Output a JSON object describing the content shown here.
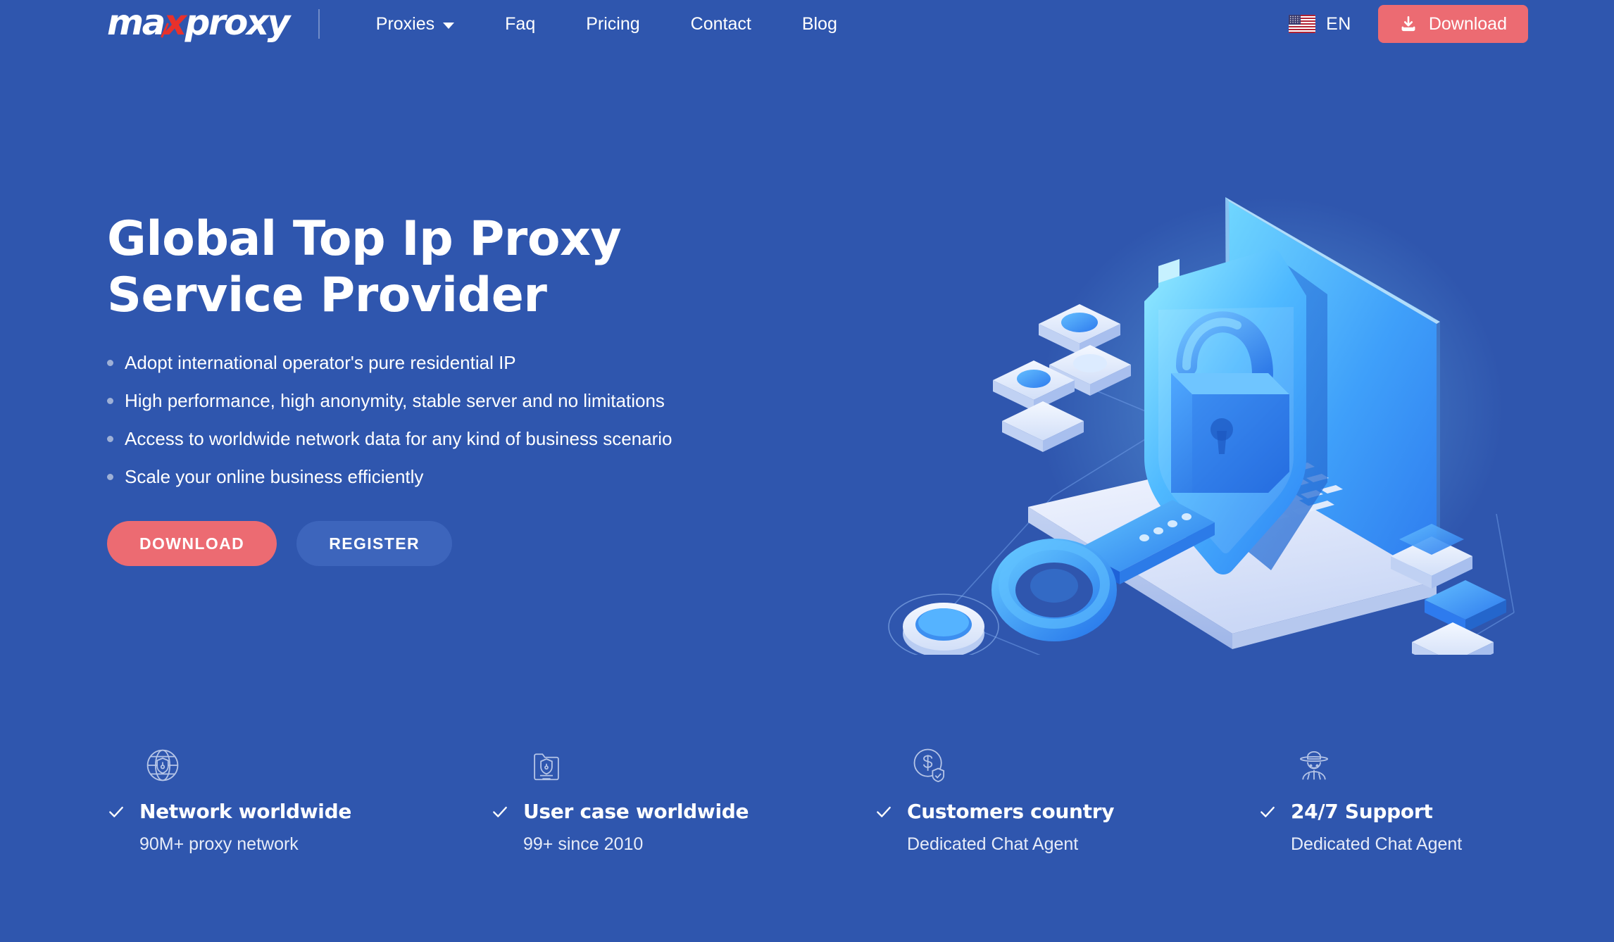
{
  "brand": {
    "name_part1": "ma",
    "name_accent": "x",
    "name_part2": "proxy",
    "accent_color": "#E8312B"
  },
  "colors": {
    "background": "#2F56AE",
    "accent_coral": "#EC6B72",
    "register_blue": "#3D65BC",
    "bullet_dot": "#9EB0D6"
  },
  "header": {
    "nav": [
      {
        "label": "Proxies",
        "has_dropdown": true
      },
      {
        "label": "Faq",
        "has_dropdown": false
      },
      {
        "label": "Pricing",
        "has_dropdown": false
      },
      {
        "label": "Contact",
        "has_dropdown": false
      },
      {
        "label": "Blog",
        "has_dropdown": false
      }
    ],
    "language": {
      "label": "EN",
      "flag_icon": "us-flag-icon"
    },
    "download_button": {
      "label": "Download",
      "icon": "download-icon"
    }
  },
  "hero": {
    "title": "Global Top Ip Proxy\nService Provider",
    "bullets": [
      "Adopt international operator's pure residential IP",
      "High performance, high anonymity, stable server and no limitations",
      "Access to worldwide network data for any kind of business scenario",
      "Scale your online business efficiently"
    ],
    "primary_cta": "DOWNLOAD",
    "secondary_cta": "REGISTER",
    "illustration_icon": "isometric-laptop-shield-lock-key-illustration"
  },
  "features": [
    {
      "icon": "globe-shield-icon",
      "title": "Network worldwide",
      "subtitle": "90M+ proxy network"
    },
    {
      "icon": "document-shield-icon",
      "title": "User case worldwide",
      "subtitle": "99+ since 2010"
    },
    {
      "icon": "dollar-coin-shield-icon",
      "title": "Customers country",
      "subtitle": "Dedicated Chat Agent"
    },
    {
      "icon": "support-agent-hat-icon",
      "title": "24/7 Support",
      "subtitle": "Dedicated Chat Agent"
    }
  ]
}
